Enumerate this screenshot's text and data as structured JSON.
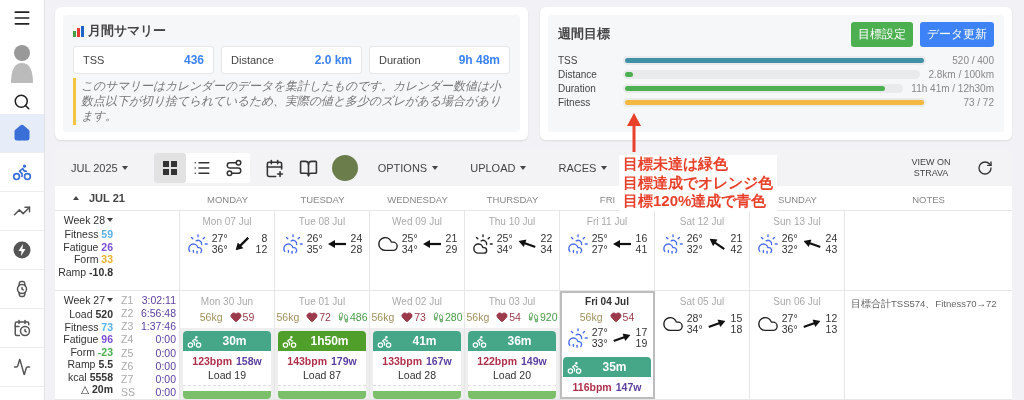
{
  "sidebar": {
    "items": [
      {
        "kind": "menu",
        "selected": false,
        "accent": false
      },
      {
        "kind": "avatar",
        "selected": false,
        "accent": false
      },
      {
        "kind": "search",
        "selected": false,
        "accent": false
      },
      {
        "kind": "home",
        "selected": true,
        "accent": true
      },
      {
        "kind": "bike",
        "selected": false,
        "accent": true
      },
      {
        "kind": "trend",
        "selected": false,
        "accent": false
      },
      {
        "kind": "power",
        "selected": false,
        "accent": false
      },
      {
        "kind": "watch",
        "selected": false,
        "accent": false
      },
      {
        "kind": "schedule",
        "selected": false,
        "accent": false
      },
      {
        "kind": "compare",
        "selected": false,
        "accent": false
      }
    ]
  },
  "monthly_summary": {
    "title": "月間サマリー",
    "stats": [
      {
        "label": "TSS",
        "value": "436"
      },
      {
        "label": "Distance",
        "value": "2.0 km"
      },
      {
        "label": "Duration",
        "value": "9h 48m"
      }
    ],
    "note": "このサマリーはカレンダーのデータを集計したものです。カレンダー数値は小数点以下が切り捨てられているため、実際の値と多少のズレがある場合があります。"
  },
  "weekly_goals": {
    "title": "週間目標",
    "buttons": [
      {
        "label": "目標設定",
        "color": "#4caf50"
      },
      {
        "label": "データ更新",
        "color": "#3d82f6"
      }
    ],
    "goals": [
      {
        "label": "TSS",
        "color": "#4191a6",
        "level": 1,
        "reading": "520 / 400"
      },
      {
        "label": "Distance",
        "color": "#4caf50",
        "level": 0.028,
        "reading": "2.8km / 100km"
      },
      {
        "label": "Duration",
        "color": "#4caf50",
        "level": 0.94,
        "reading": "11h 41m / 12h30m"
      },
      {
        "label": "Fitness",
        "color": "#f4b73f",
        "level": 1,
        "reading": "73 / 72"
      }
    ]
  },
  "toolbar": {
    "month": "JUL 2025",
    "view_modes": [
      {
        "kind": "grid",
        "selected": true
      },
      {
        "kind": "list",
        "selected": false
      },
      {
        "kind": "route",
        "selected": false
      }
    ],
    "menus": [
      "OPTIONS",
      "UPLOAD",
      "RACES"
    ],
    "strava_link": "VIEW ON STRAVA"
  },
  "calendar": {
    "current_week": "JUL 21",
    "day_headers": [
      {
        "label": "MONDAY",
        "covered": false
      },
      {
        "label": "TUESDAY",
        "covered": false
      },
      {
        "label": "WEDNESDAY",
        "covered": false
      },
      {
        "label": "THURSDAY",
        "covered": false
      },
      {
        "label": "FRI",
        "covered": false
      },
      {
        "covered": true
      },
      {
        "label": "SUNDAY",
        "covered": false
      },
      {
        "label": "NOTES",
        "covered": false
      }
    ],
    "weeks": [
      {
        "label": "Week 28",
        "stats": [
          {
            "label": "Fitness",
            "value": "59",
            "color": "#5ab0e8"
          },
          {
            "label": "Fatigue",
            "value": "26",
            "color": "#7b4fd6"
          },
          {
            "label": "Form",
            "value": "33",
            "color": "#e8b030"
          },
          {
            "label": "Ramp",
            "value": "-10.8",
            "color": "#333333"
          }
        ],
        "days": [
          {
            "date": "Mon 07 Jul",
            "selected": false,
            "weather": {
              "kind": "rain",
              "temps": [
                "27°",
                "36°"
              ],
              "wind": {
                "kind": "sw",
                "values": [
                  "8",
                  "12"
                ]
              }
            }
          },
          {
            "date": "Tue 08 Jul",
            "selected": false,
            "weather": {
              "kind": "rain",
              "temps": [
                "26°",
                "35°"
              ],
              "wind": {
                "kind": "w",
                "values": [
                  "24",
                  "28"
                ]
              }
            }
          },
          {
            "date": "Wed 09 Jul",
            "selected": false,
            "weather": {
              "kind": "cloud",
              "temps": [
                "25°",
                "34°"
              ],
              "wind": {
                "kind": "w",
                "values": [
                  "21",
                  "29"
                ]
              }
            }
          },
          {
            "date": "Thu 10 Jul",
            "selected": false,
            "weather": {
              "kind": "partly",
              "temps": [
                "25°",
                "34°"
              ],
              "wind": {
                "kind": "wnw",
                "values": [
                  "22",
                  "34"
                ]
              }
            }
          },
          {
            "date": "Fri 11 Jul",
            "selected": false,
            "weather": {
              "kind": "rain",
              "temps": [
                "25°",
                "27°"
              ],
              "wind": {
                "kind": "w",
                "values": [
                  "16",
                  "41"
                ]
              }
            }
          },
          {
            "date": "Sat 12 Jul",
            "selected": false,
            "weather": {
              "kind": "rain",
              "temps": [
                "26°",
                "32°"
              ],
              "wind": {
                "kind": "nw",
                "values": [
                  "21",
                  "42"
                ]
              }
            }
          },
          {
            "date": "Sun 13 Jul",
            "selected": false,
            "weather": {
              "kind": "rain",
              "temps": [
                "26°",
                "32°"
              ],
              "wind": {
                "kind": "wnw",
                "values": [
                  "24",
                  "43"
                ]
              }
            }
          }
        ]
      },
      {
        "label": "Week 27",
        "stats": [
          {
            "label": "Load",
            "value": "520",
            "color": "#333333"
          },
          {
            "label": "Fitness",
            "value": "73",
            "color": "#5ab0e8"
          },
          {
            "label": "Fatigue",
            "value": "96",
            "color": "#7b4fd6"
          },
          {
            "label": "Form",
            "value": "-23",
            "color": "#4caf50"
          },
          {
            "label": "Ramp",
            "value": "5.5",
            "color": "#333333"
          },
          {
            "label": "kcal",
            "value": "5558",
            "color": "#333333"
          },
          {
            "label": "△",
            "value": "20m",
            "color": "#333333"
          }
        ],
        "zones": [
          {
            "label": "Z1",
            "value": "3:02:11"
          },
          {
            "label": "Z2",
            "value": "6:56:48"
          },
          {
            "label": "Z3",
            "value": "1:37:46"
          },
          {
            "label": "Z4",
            "value": "0:00"
          },
          {
            "label": "Z5",
            "value": "0:00"
          },
          {
            "label": "Z6",
            "value": "0:00"
          },
          {
            "label": "Z7",
            "value": "0:00"
          },
          {
            "label": "SS",
            "value": "0:00"
          }
        ],
        "days": [
          {
            "date": "Mon 30 Jun",
            "selected": false,
            "weight": "56kg",
            "heart": "59",
            "activity": {
              "duration": "30m",
              "color": "#46a688",
              "hr": "123bpm",
              "power": "158w",
              "load": "Load 19"
            }
          },
          {
            "date": "Tue 01 Jul",
            "selected": false,
            "weight": "56kg",
            "heart": "72",
            "steps": "486",
            "activity": {
              "duration": "1h50m",
              "color": "#4f9f2a",
              "hr": "143bpm",
              "power": "179w",
              "load": "Load 87"
            }
          },
          {
            "date": "Wed 02 Jul",
            "selected": false,
            "weight": "56kg",
            "heart": "73",
            "steps": "280",
            "activity": {
              "duration": "41m",
              "color": "#46a688",
              "hr": "133bpm",
              "power": "167w",
              "load": "Load 28"
            }
          },
          {
            "date": "Thu 03 Jul",
            "selected": false,
            "weight": "56kg",
            "heart": "54",
            "steps": "920",
            "activity": {
              "duration": "36m",
              "color": "#46a688",
              "hr": "122bpm",
              "power": "149w",
              "load": "Load 20"
            }
          },
          {
            "date": "Fri 04 Jul",
            "selected": true,
            "weight": "56kg",
            "heart": "54",
            "weather": {
              "kind": "rain",
              "temps": [
                "27°",
                "33°"
              ],
              "wind": {
                "kind": "ene",
                "values": [
                  "17",
                  "19"
                ]
              }
            },
            "activity": {
              "duration": "35m",
              "color": "#46a688",
              "hr": "116bpm",
              "power": "147w"
            }
          },
          {
            "date": "Sat 05 Jul",
            "selected": false,
            "weather": {
              "kind": "cloud",
              "temps": [
                "28°",
                "34°"
              ],
              "wind": {
                "kind": "ene",
                "values": [
                  "15",
                  "18"
                ]
              }
            }
          },
          {
            "date": "Sun 06 Jul",
            "selected": false,
            "weather": {
              "kind": "cloud",
              "temps": [
                "27°",
                "36°"
              ],
              "wind": {
                "kind": "ene",
                "values": [
                  "12",
                  "13"
                ]
              }
            }
          }
        ],
        "note": "目標合計TSS574、Fitness70→72"
      }
    ]
  },
  "annotation": {
    "lines": [
      "目標未達は緑色",
      "目標達成でオレンジ色",
      "目標120%達成で青色"
    ]
  }
}
